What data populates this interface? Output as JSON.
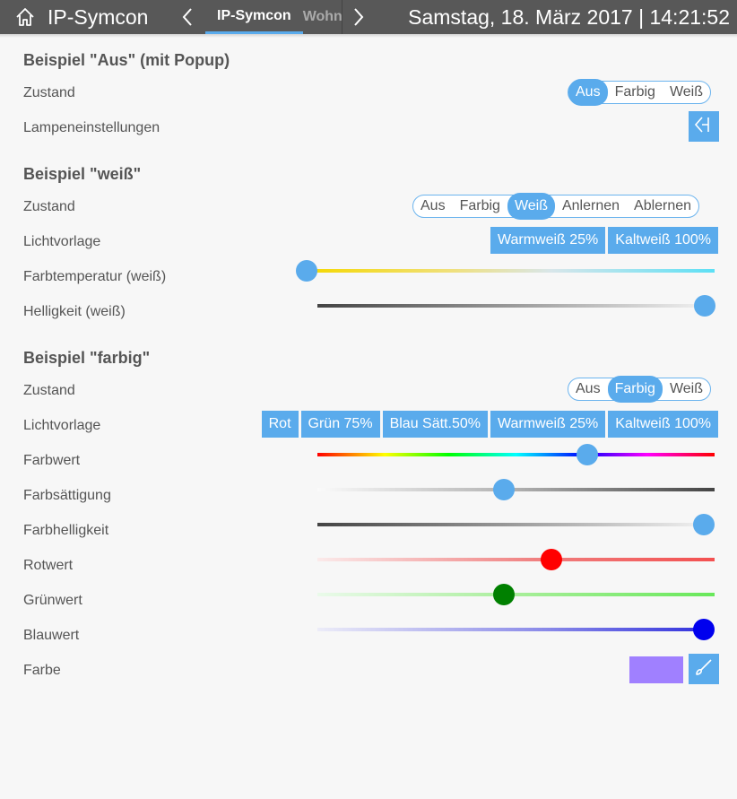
{
  "header": {
    "app_title": "IP-Symcon",
    "tabs": [
      {
        "label": "IP-Symcon"
      },
      {
        "label": "Wohnzimmer"
      }
    ],
    "datetime": "Samstag, 18. März 2017 | 14:21:52"
  },
  "sections": {
    "aus": {
      "title": "Beispiel \"Aus\" (mit Popup)",
      "zustand_label": "Zustand",
      "zustand_options": [
        "Aus",
        "Farbig",
        "Weiß"
      ],
      "zustand_selected": "Aus",
      "lampe_label": "Lampeneinstellungen"
    },
    "weiss": {
      "title": "Beispiel \"weiß\"",
      "zustand_label": "Zustand",
      "zustand_options": [
        "Aus",
        "Farbig",
        "Weiß",
        "Anlernen",
        "Ablernen"
      ],
      "zustand_selected": "Weiß",
      "lichtvorlage_label": "Lichtvorlage",
      "presets": [
        "Warmweiß 25%",
        "Kaltweiß 100%"
      ],
      "farbtemperatur_label": "Farbtemperatur (weiß)",
      "farbtemperatur_value": 0.0,
      "helligkeit_label": "Helligkeit (weiß)",
      "helligkeit_value": 1.0
    },
    "farbig": {
      "title": "Beispiel \"farbig\"",
      "zustand_label": "Zustand",
      "zustand_options": [
        "Aus",
        "Farbig",
        "Weiß"
      ],
      "zustand_selected": "Farbig",
      "lichtvorlage_label": "Lichtvorlage",
      "presets": [
        "Rot",
        "Grün 75%",
        "Blau Sätt.50%",
        "Warmweiß 25%",
        "Kaltweiß 100%"
      ],
      "farbwert_label": "Farbwert",
      "farbwert_value": 0.68,
      "farbsaettigung_label": "Farbsättigung",
      "farbsaettigung_value": 0.47,
      "farbhelligkeit_label": "Farbhelligkeit",
      "farbhelligkeit_value": 1.0,
      "rotwert_label": "Rotwert",
      "rotwert_value": 0.59,
      "gruenwert_label": "Grünwert",
      "gruenwert_value": 0.47,
      "blauwert_label": "Blauwert",
      "blauwert_value": 1.0,
      "farbe_label": "Farbe",
      "farbe_color": "#a080ff"
    }
  },
  "colors": {
    "accent": "#5aabec",
    "header_bg": "#585858",
    "knob_red": "#ff0000",
    "knob_green": "#008000",
    "knob_blue": "#0000ee"
  },
  "icons": {
    "home": "home-icon",
    "back": "chevron-left-icon",
    "forward": "chevron-right-icon",
    "popup": "popup-arrow-icon",
    "brush": "brush-icon"
  }
}
